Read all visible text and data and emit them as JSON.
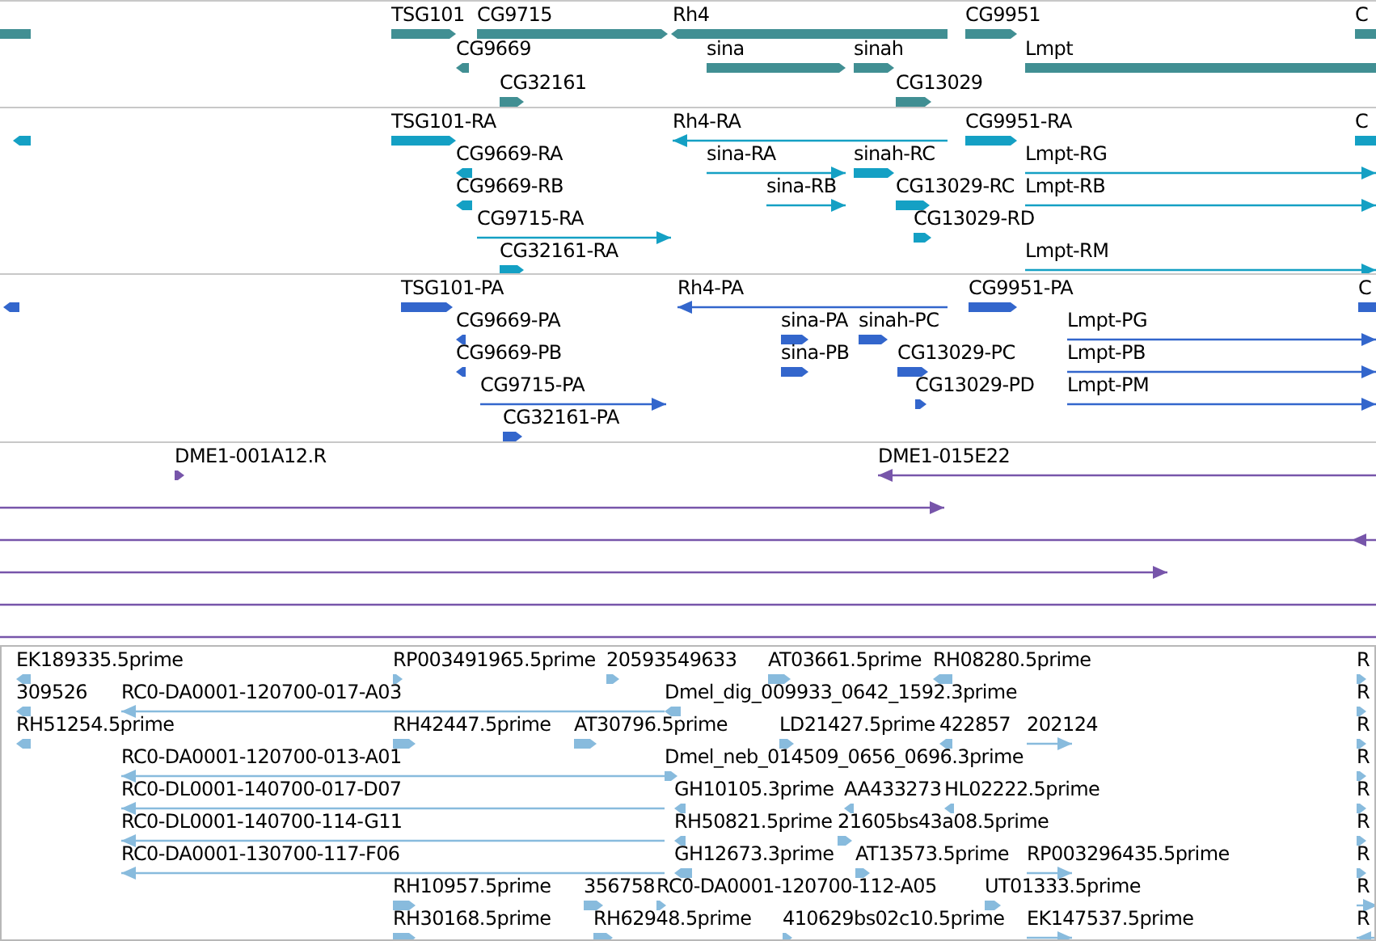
{
  "tracks": [
    {
      "color": "#418f93",
      "features": [
        {
          "reverse": true
        },
        {
          "label": "TSG101",
          "reverse": false
        },
        {
          "label": "CG9715",
          "reverse": false
        },
        {
          "label": "Rh4",
          "reverse": true
        },
        {
          "label": "CG9951",
          "reverse": false
        },
        {
          "label": "C",
          "reverse": false
        },
        {
          "label": "CG9669",
          "reverse": true
        },
        {
          "label": "sina",
          "reverse": false
        },
        {
          "label": "sinah",
          "reverse": false
        },
        {
          "label": "Lmpt",
          "reverse": false
        },
        {
          "label": "CG32161",
          "reverse": false
        },
        {
          "label": "CG13029",
          "reverse": false
        }
      ]
    },
    {
      "color": "#14a0c4",
      "features": [
        {
          "reverse": true
        },
        {
          "label": "TSG101-RA",
          "reverse": false
        },
        {
          "label": "Rh4-RA",
          "reverse": true
        },
        {
          "label": "CG9951-RA",
          "reverse": false
        },
        {
          "label": "C",
          "reverse": false
        },
        {
          "label": "CG9669-RA",
          "reverse": true
        },
        {
          "label": "sina-RA",
          "reverse": false
        },
        {
          "label": "sinah-RC",
          "reverse": false
        },
        {
          "label": "Lmpt-RG",
          "reverse": false
        },
        {
          "label": "CG9669-RB",
          "reverse": true
        },
        {
          "label": "sina-RB",
          "reverse": false
        },
        {
          "label": "CG13029-RC",
          "reverse": false
        },
        {
          "label": "Lmpt-RB",
          "reverse": false
        },
        {
          "label": "CG9715-RA",
          "reverse": false
        },
        {
          "label": "CG13029-RD",
          "reverse": false
        },
        {
          "label": "CG32161-RA",
          "reverse": false
        },
        {
          "label": "Lmpt-RM",
          "reverse": false
        }
      ]
    },
    {
      "color": "#3366cc",
      "features": [
        {
          "reverse": true
        },
        {
          "label": "TSG101-PA",
          "reverse": false
        },
        {
          "label": "Rh4-PA",
          "reverse": true
        },
        {
          "label": "CG9951-PA",
          "reverse": false
        },
        {
          "label": "C",
          "reverse": false
        },
        {
          "label": "CG9669-PA",
          "reverse": true
        },
        {
          "label": "sina-PA",
          "reverse": false
        },
        {
          "label": "sinah-PC",
          "reverse": false
        },
        {
          "label": "Lmpt-PG",
          "reverse": false
        },
        {
          "label": "CG9669-PB",
          "reverse": true
        },
        {
          "label": "sina-PB",
          "reverse": false
        },
        {
          "label": "CG13029-PC",
          "reverse": false
        },
        {
          "label": "Lmpt-PB",
          "reverse": false
        },
        {
          "label": "CG9715-PA",
          "reverse": false
        },
        {
          "label": "CG13029-PD",
          "reverse": false
        },
        {
          "label": "Lmpt-PM",
          "reverse": false
        },
        {
          "label": "CG32161-PA",
          "reverse": false
        }
      ]
    },
    {
      "color": "#7755aa",
      "features": [
        {
          "label": "DME1-001A12.R",
          "reverse": false
        },
        {
          "label": "DME1-015E22",
          "reverse": true
        },
        {
          "reverse": false
        },
        {
          "reverse": true
        },
        {
          "reverse": false
        },
        {
          "reverse": false
        },
        {
          "reverse": false
        }
      ]
    },
    {
      "color": "#88bbdd",
      "boxed": true,
      "features": [
        {
          "label": "EK189335.5prime",
          "reverse": true
        },
        {
          "label": "RP003491965.5prime",
          "reverse": false
        },
        {
          "label": "20593549633",
          "reverse": false
        },
        {
          "label": "AT03661.5prime",
          "reverse": false
        },
        {
          "label": "RH08280.5prime",
          "reverse": true
        },
        {
          "label": "R",
          "reverse": false
        },
        {
          "label": "309526",
          "reverse": true
        },
        {
          "label": "RC0-DA0001-120700-017-A03",
          "reverse": true
        },
        {
          "label": "Dmel_dig_009933_0642_1592.3prime",
          "reverse": true
        },
        {
          "label": "R",
          "reverse": false
        },
        {
          "label": "RH51254.5prime",
          "reverse": true
        },
        {
          "label": "RH42447.5prime",
          "reverse": false
        },
        {
          "label": "AT30796.5prime",
          "reverse": false
        },
        {
          "label": "LD21427.5prime",
          "reverse": false
        },
        {
          "label": "422857",
          "reverse": true
        },
        {
          "label": "202124",
          "reverse": false
        },
        {
          "label": "R",
          "reverse": false
        },
        {
          "label": "RC0-DA0001-120700-013-A01",
          "reverse": true
        },
        {
          "label": "Dmel_neb_014509_0656_0696.3prime",
          "reverse": false
        },
        {
          "label": "R",
          "reverse": false
        },
        {
          "label": "RC0-DL0001-140700-017-D07",
          "reverse": true
        },
        {
          "label": "GH10105.3prime",
          "reverse": true
        },
        {
          "label": "AA433273",
          "reverse": true
        },
        {
          "label": "HL02222.5prime",
          "reverse": true
        },
        {
          "label": "R",
          "reverse": false
        },
        {
          "label": "RC0-DL0001-140700-114-G11",
          "reverse": true
        },
        {
          "label": "RH50821.5prime",
          "reverse": true
        },
        {
          "label": "21605bs43a08.5prime",
          "reverse": false
        },
        {
          "label": "R",
          "reverse": false
        },
        {
          "label": "RC0-DA0001-130700-117-F06",
          "reverse": true
        },
        {
          "label": "GH12673.3prime",
          "reverse": true
        },
        {
          "label": "AT13573.5prime",
          "reverse": false
        },
        {
          "label": "RP003296435.5prime",
          "reverse": false
        },
        {
          "label": "R",
          "reverse": false
        },
        {
          "label": "RH10957.5prime",
          "reverse": false
        },
        {
          "label": "356758",
          "reverse": false
        },
        {
          "label": "RC0-DA0001-120700-112-A05",
          "reverse": false
        },
        {
          "label": "UT01333.5prime",
          "reverse": false
        },
        {
          "label": "R",
          "reverse": false
        },
        {
          "label": "RH30168.5prime",
          "reverse": false
        },
        {
          "label": "RH62948.5prime",
          "reverse": false
        },
        {
          "label": "410629bs02c10.5prime",
          "reverse": false
        },
        {
          "label": "EK147537.5prime",
          "reverse": false
        },
        {
          "label": "R",
          "reverse": true
        }
      ]
    }
  ]
}
